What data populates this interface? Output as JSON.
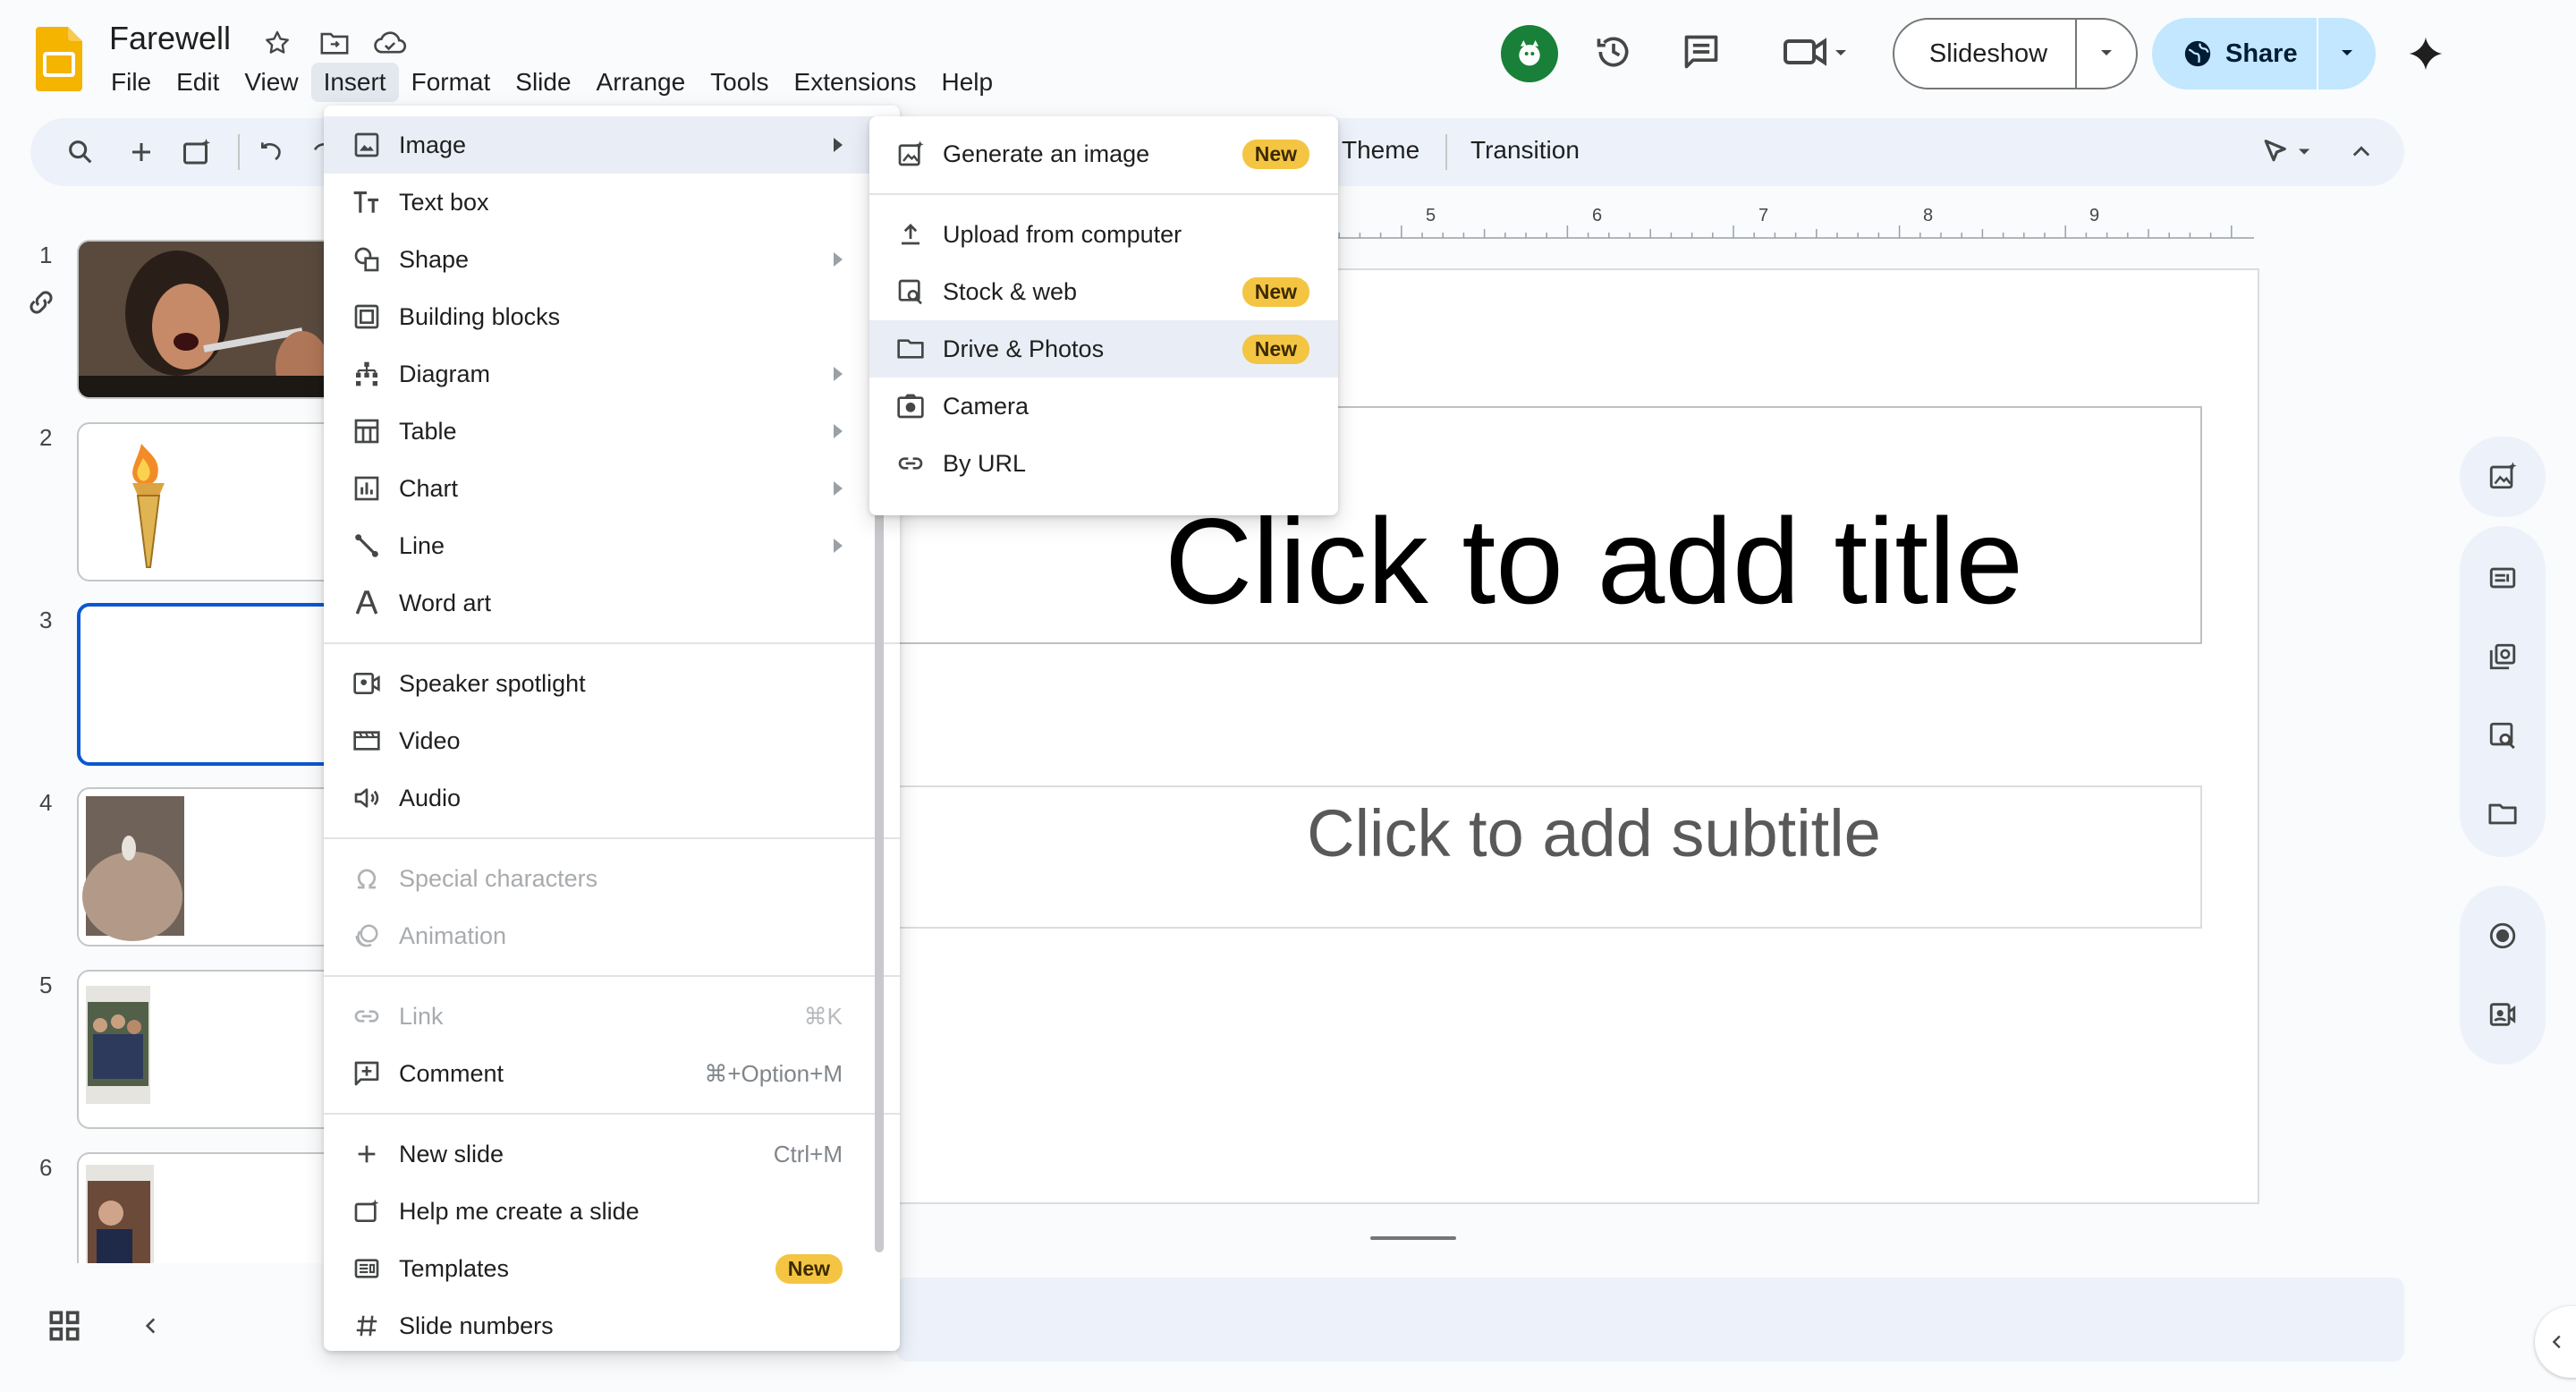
{
  "app": {
    "doc_title": "Farewell",
    "menus": [
      "File",
      "Edit",
      "View",
      "Insert",
      "Format",
      "Slide",
      "Arrange",
      "Tools",
      "Extensions",
      "Help"
    ],
    "active_menu": "Insert"
  },
  "header": {
    "slideshow_label": "Slideshow",
    "share_label": "Share",
    "accent": "#c2e7ff",
    "avatar_color": "#188038"
  },
  "toolbar": {
    "theme_label": "Theme",
    "transition_label": "Transition"
  },
  "ruler": {
    "numbers": [
      "5",
      "6",
      "7",
      "8",
      "9"
    ]
  },
  "filmstrip": {
    "slides": [
      {
        "num": "1"
      },
      {
        "num": "2"
      },
      {
        "num": "3"
      },
      {
        "num": "4"
      },
      {
        "num": "5"
      },
      {
        "num": "6"
      }
    ],
    "selected": "3"
  },
  "slide": {
    "title_placeholder": "Click to add title",
    "subtitle_placeholder": "Click to add subtitle"
  },
  "insert_menu": {
    "groups": [
      [
        {
          "label": "Image",
          "icon": "image-icon",
          "submenu": true,
          "hover": true
        },
        {
          "label": "Text box",
          "icon": "text-box-icon"
        },
        {
          "label": "Shape",
          "icon": "shape-icon",
          "submenu": true
        },
        {
          "label": "Building blocks",
          "icon": "building-blocks-icon"
        },
        {
          "label": "Diagram",
          "icon": "diagram-icon",
          "submenu": true
        },
        {
          "label": "Table",
          "icon": "table-icon",
          "submenu": true
        },
        {
          "label": "Chart",
          "icon": "chart-icon",
          "submenu": true
        },
        {
          "label": "Line",
          "icon": "line-icon",
          "submenu": true
        },
        {
          "label": "Word art",
          "icon": "word-art-icon"
        }
      ],
      [
        {
          "label": "Speaker spotlight",
          "icon": "speaker-spotlight-icon"
        },
        {
          "label": "Video",
          "icon": "video-icon"
        },
        {
          "label": "Audio",
          "icon": "audio-icon"
        }
      ],
      [
        {
          "label": "Special characters",
          "icon": "omega-icon",
          "disabled": true
        },
        {
          "label": "Animation",
          "icon": "animation-icon",
          "disabled": true
        }
      ],
      [
        {
          "label": "Link",
          "icon": "link-icon",
          "shortcut": "⌘K",
          "disabled": true
        },
        {
          "label": "Comment",
          "icon": "comment-icon",
          "shortcut": "⌘+Option+M"
        }
      ],
      [
        {
          "label": "New slide",
          "icon": "plus-icon",
          "shortcut": "Ctrl+M"
        },
        {
          "label": "Help me create a slide",
          "icon": "sparkle-slide-icon"
        },
        {
          "label": "Templates",
          "icon": "templates-icon",
          "badge": "New"
        },
        {
          "label": "Slide numbers",
          "icon": "hash-icon"
        }
      ]
    ]
  },
  "image_submenu": {
    "groups": [
      [
        {
          "label": "Generate an image",
          "icon": "generate-image-icon",
          "badge": "New"
        }
      ],
      [
        {
          "label": "Upload from computer",
          "icon": "upload-icon"
        },
        {
          "label": "Stock & web",
          "icon": "stock-web-icon",
          "badge": "New"
        },
        {
          "label": "Drive & Photos",
          "icon": "folder-icon",
          "badge": "New",
          "hover": true
        },
        {
          "label": "Camera",
          "icon": "camera-icon"
        },
        {
          "label": "By URL",
          "icon": "url-link-icon"
        }
      ]
    ]
  }
}
